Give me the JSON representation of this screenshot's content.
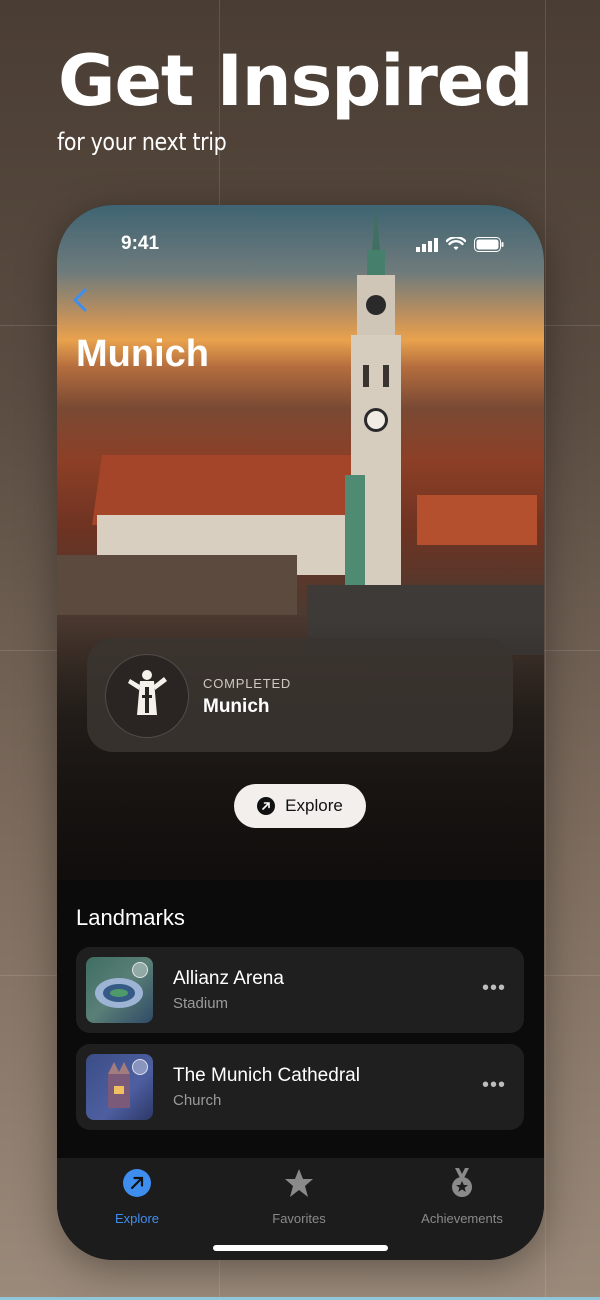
{
  "promo": {
    "headline": "Get Inspired",
    "subheadline": "for your next trip"
  },
  "status_bar": {
    "time": "9:41"
  },
  "city": {
    "title": "Munich"
  },
  "completed_card": {
    "kicker": "COMPLETED",
    "title": "Munich"
  },
  "explore_button": {
    "label": "Explore"
  },
  "landmarks": {
    "section_title": "Landmarks",
    "items": [
      {
        "name": "Allianz Arena",
        "type": "Stadium",
        "more": "•••"
      },
      {
        "name": "The Munich Cathedral",
        "type": "Church",
        "more": "•••"
      }
    ]
  },
  "tabbar": {
    "tabs": [
      {
        "label": "Explore",
        "icon": "explore-arrow-icon",
        "active": true
      },
      {
        "label": "Favorites",
        "icon": "star-icon",
        "active": false
      },
      {
        "label": "Achievements",
        "icon": "medal-icon",
        "active": false
      }
    ]
  },
  "colors": {
    "accent": "#3e8ef0",
    "inactive": "#8a8a8a",
    "background_top": "#4a3d33",
    "background_bottom": "#9b8a7a"
  }
}
